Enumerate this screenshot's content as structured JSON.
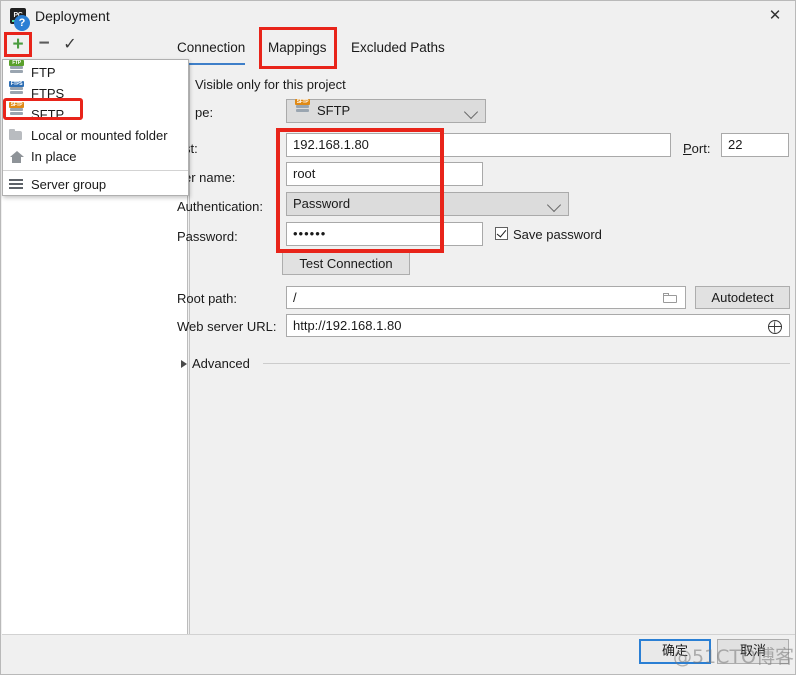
{
  "window": {
    "title": "Deployment",
    "app_icon": "PC",
    "close_icon": "✕"
  },
  "toolbar": {
    "add_label": "+",
    "remove_label": "−",
    "check_label": "✓"
  },
  "dropdown": {
    "items": [
      {
        "label": "FTP",
        "icon": "ftp-server-icon",
        "badge": "FTP"
      },
      {
        "label": "FTPS",
        "icon": "ftps-server-icon",
        "badge": "FTPS"
      },
      {
        "label": "SFTP",
        "icon": "sftp-server-icon",
        "badge": "SFTP"
      },
      {
        "label": "Local or mounted folder",
        "icon": "folder-icon",
        "badge": ""
      },
      {
        "label": "In place",
        "icon": "home-icon",
        "badge": ""
      },
      {
        "label": "Server group",
        "icon": "server-group-icon",
        "badge": ""
      }
    ],
    "highlighted_item": "SFTP"
  },
  "tabs": [
    {
      "label": "Connection",
      "active": true
    },
    {
      "label": "Mappings",
      "active": false
    },
    {
      "label": "Excluded Paths",
      "active": false
    }
  ],
  "form": {
    "visible_only_label": "Visible only for this project",
    "type_label": "pe:",
    "type_value": "SFTP",
    "host_label": "st:",
    "host_value": "192.168.1.80",
    "port_label": "Port:",
    "port_value": "22",
    "username_label": "er name:",
    "username_value": "root",
    "auth_label": "Authentication:",
    "auth_value": "Password",
    "password_label": "Password:",
    "password_value": "••••••",
    "save_password_label": "Save password",
    "save_password_checked": true,
    "test_connection_label": "Test Connection",
    "root_path_label": "Root path:",
    "root_path_value": "/",
    "autodetect_label": "Autodetect",
    "web_url_label": "Web server URL:",
    "web_url_value": "http://192.168.1.80",
    "advanced_label": "Advanced"
  },
  "footer": {
    "help_label": "?",
    "ok_label": "确定",
    "cancel_label": "取消",
    "watermark": "@51CTO博客"
  },
  "colors": {
    "highlight_red": "#e8241a",
    "accent_blue": "#3e7fc9",
    "ftp_green": "#5aa02c",
    "ftps_blue": "#2f6fb5",
    "sftp_orange": "#e08a16"
  }
}
